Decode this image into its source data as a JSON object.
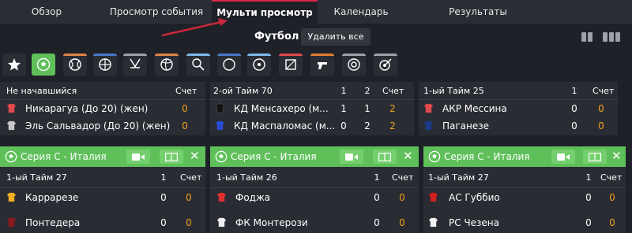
{
  "nav": {
    "tabs": [
      "Обзор",
      "Просмотр события",
      "Мульти просмотр",
      "Календарь",
      "Результаты"
    ],
    "active_index": 2
  },
  "toolbar": {
    "sport_title": "Футбол",
    "delete_all_label": "Удалить все"
  },
  "sports": [
    {
      "icon": "star-icon",
      "color": "#2b2d35"
    },
    {
      "icon": "soccer-ball-icon",
      "color": "#5fc05a"
    },
    {
      "icon": "tennis-icon",
      "color": "#e0844a"
    },
    {
      "icon": "basketball-icon",
      "color": "#4a78c8"
    },
    {
      "icon": "hockey-icon",
      "color": "#9ea1a8"
    },
    {
      "icon": "volleyball-icon",
      "color": "#e0844a"
    },
    {
      "icon": "badminton-icon",
      "color": "#7fb8e8"
    },
    {
      "icon": "ball-icon",
      "color": "#4a78c8"
    },
    {
      "icon": "snooker-icon",
      "color": "#7fb8e8"
    },
    {
      "icon": "handball-icon",
      "color": "#e04a4a"
    },
    {
      "icon": "shooter-icon",
      "color": "#e08030"
    },
    {
      "icon": "target-icon",
      "color": "#9ea1a8"
    },
    {
      "icon": "darts-icon",
      "color": "#9ea1a8"
    }
  ],
  "top_matches": [
    {
      "status": "Не начавшийся",
      "score_label": "Счет",
      "team1": {
        "name": "Никарагуа (До 20) (жен)",
        "shirt": "#e04a4a",
        "scores": [
          "0"
        ]
      },
      "team2": {
        "name": "Эль Сальвадор (До 20) (жен)",
        "shirt": "#c8c8c8",
        "scores": [
          "0"
        ]
      },
      "period_cols": []
    },
    {
      "status": "2-ой Тайм 70",
      "score_label": "Счет",
      "period_cols": [
        "1",
        "2"
      ],
      "team1": {
        "name": "КД Менсахеро (м...",
        "shirt": "#111111",
        "scores": [
          "1",
          "1",
          "2"
        ]
      },
      "team2": {
        "name": "КД Маспаломас (м...",
        "shirt": "#2a4ad0",
        "scores": [
          "0",
          "2",
          "2"
        ]
      }
    },
    {
      "status": "1-ый Тайм 25",
      "score_label": "Счет",
      "period_cols": [
        "1"
      ],
      "team1": {
        "name": "АКР Мессина",
        "shirt": "#e04a4a",
        "scores": [
          "0",
          "0"
        ]
      },
      "team2": {
        "name": "Паганезе",
        "shirt": "#1a3a8a",
        "scores": [
          "0",
          "0"
        ]
      }
    }
  ],
  "bottom_matches": [
    {
      "league": "Серия C - Италия",
      "status": "1-ый Тайм 27",
      "period_col": "1",
      "score_label": "Счет",
      "team1": {
        "name": "Каррарезе",
        "shirt": "#f0b020",
        "scores": [
          "0",
          "0"
        ]
      },
      "team2": {
        "name": "Понтедера",
        "shirt": "#8a1a20",
        "scores": [
          "0",
          "0"
        ]
      }
    },
    {
      "league": "Серия C - Италия",
      "status": "1-ый Тайм 26",
      "period_col": "1",
      "score_label": "Счет",
      "team1": {
        "name": "Фоджа",
        "shirt": "#e03030",
        "scores": [
          "0",
          "0"
        ]
      },
      "team2": {
        "name": "ФК Монтерози",
        "shirt": "#f0f0f0",
        "scores": [
          "0",
          "0"
        ]
      }
    },
    {
      "league": "Серия C - Италия",
      "status": "1-ый Тайм 27",
      "period_col": "1",
      "score_label": "Счет",
      "team1": {
        "name": "АС Губбио",
        "shirt": "#d02020",
        "scores": [
          "0",
          "0"
        ]
      },
      "team2": {
        "name": "РС Чезена",
        "shirt": "#f0f0f0",
        "scores": [
          "0",
          "0"
        ]
      }
    }
  ],
  "colors": {
    "accent_green": "#5fc05a",
    "score_orange": "#f0a020",
    "active_tab_line": "#e0254a",
    "annotation_arrow": "#c8283c"
  }
}
